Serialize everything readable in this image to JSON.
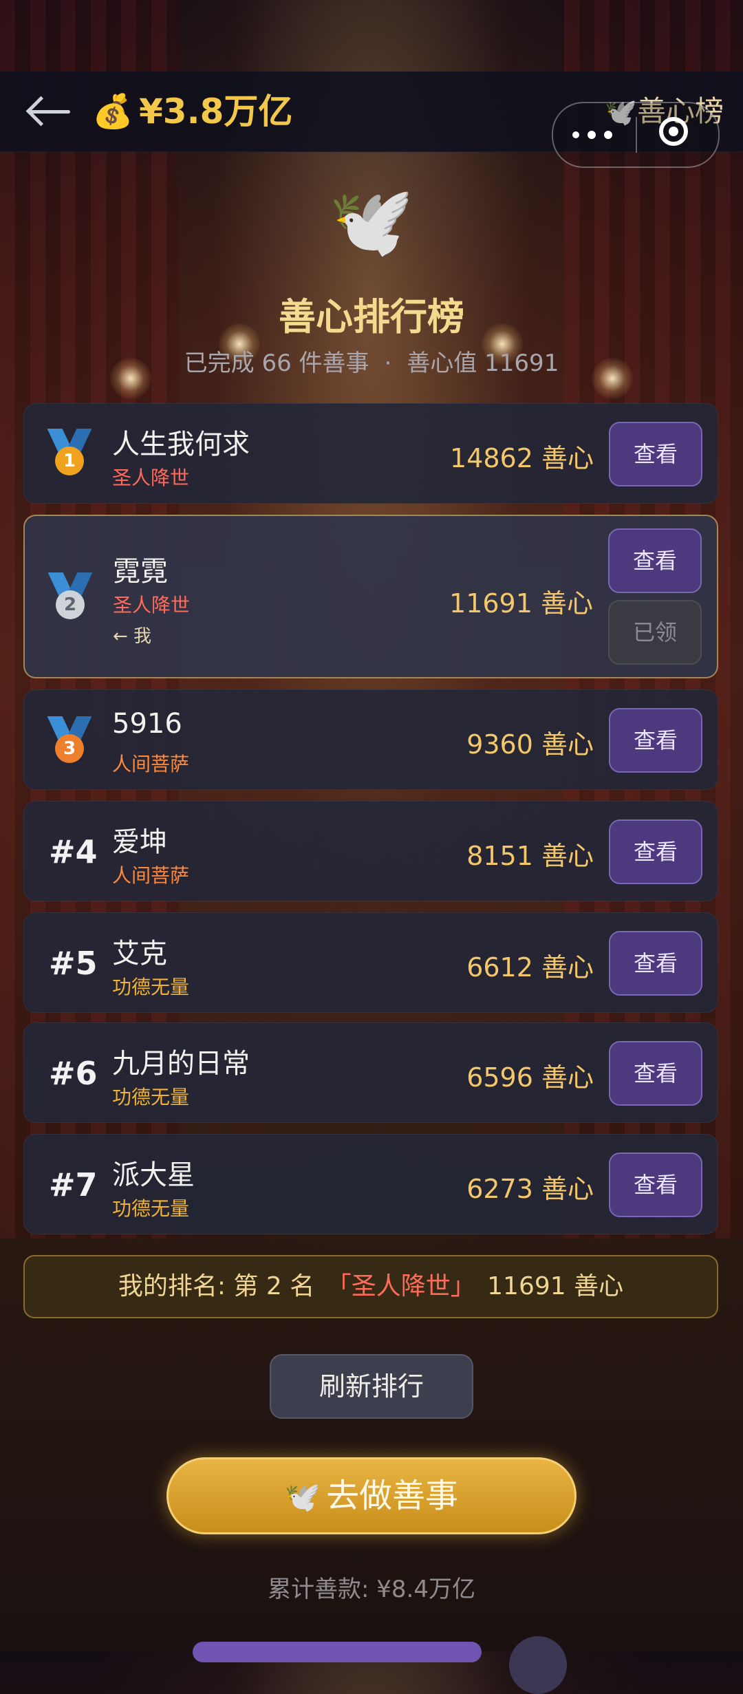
{
  "header": {
    "money_icon": "💰",
    "money": "¥3.8万亿",
    "right_icon": "🕊️",
    "right_title": "善心榜"
  },
  "hero": {
    "dove": "🕊️",
    "title": "善心排行榜",
    "stats_left": "已完成 66 件善事",
    "stats_sep": "·",
    "stats_right": "善心值 11691"
  },
  "rows": [
    {
      "rank": "1",
      "name": "人生我何求",
      "title": "圣人降世",
      "title_color": "#ff6b5a",
      "score": "14862 善心",
      "view": "查看"
    },
    {
      "rank": "2",
      "name": "霓霓",
      "title": "圣人降世",
      "title_color": "#ff6b5a",
      "me_tag": "← 我",
      "score": "11691 善心",
      "view": "查看",
      "claimed": "已领"
    },
    {
      "rank": "3",
      "name": "5916",
      "title": "人间菩萨",
      "title_color": "#ff8a3c",
      "score": "9360 善心",
      "view": "查看"
    },
    {
      "rank": "#4",
      "name": "爱坤",
      "title": "人间菩萨",
      "title_color": "#ff8a3c",
      "score": "8151 善心",
      "view": "查看"
    },
    {
      "rank": "#5",
      "name": "艾克",
      "title": "功德无量",
      "title_color": "#f0b233",
      "score": "6612 善心",
      "view": "查看"
    },
    {
      "rank": "#6",
      "name": "九月的日常",
      "title": "功德无量",
      "title_color": "#f0b233",
      "score": "6596 善心",
      "view": "查看"
    },
    {
      "rank": "#7",
      "name": "派大星",
      "title": "功德无量",
      "title_color": "#f0b233",
      "score": "6273 善心",
      "view": "查看"
    }
  ],
  "my_rank": {
    "prefix": "我的排名: 第 2 名",
    "title": "「圣人降世」",
    "score": "11691 善心"
  },
  "refresh_label": "刷新排行",
  "go_label": "去做善事",
  "go_icon": "🕊️",
  "total": "累计善款: ¥8.4万亿",
  "colors": {
    "accent_gold": "#f3c84a",
    "button_purple": "#4d3a7e"
  }
}
